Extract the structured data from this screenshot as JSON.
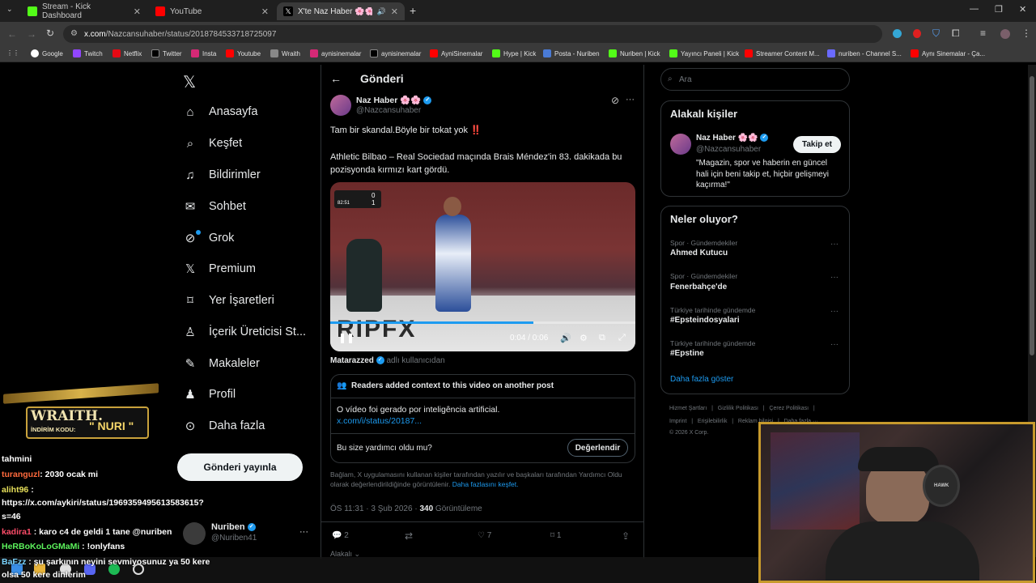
{
  "browser": {
    "tabs": [
      {
        "label": "Stream - Kick Dashboard",
        "icon": "kick-icon",
        "color": "#53fc18"
      },
      {
        "label": "YouTube",
        "icon": "youtube-icon",
        "color": "#ff0000"
      },
      {
        "label": "X'te Naz Haber 🌸🌸: \"Tam",
        "icon": "x-icon",
        "color": "#ffffff"
      }
    ],
    "url_host": "x.com",
    "url_path": "/Nazcansuhaber/status/2018784533718725097",
    "bookmarks": [
      "Google",
      "Twitch",
      "Netflix",
      "Twitter",
      "Insta",
      "Youtube",
      "Wraith",
      "aynisinemalar",
      "aynisinemalar",
      "AyniSinemalar",
      "Hype | Kick",
      "Posta - Nuriben",
      "Nuriben | Kick",
      "Yayıncı Paneli | Kick",
      "Streamer Content M...",
      "nuriben - Channel S...",
      "Aynı Sinemalar - Ça..."
    ]
  },
  "nav": {
    "items": [
      {
        "label": "Anasayfa",
        "icon": "home-icon"
      },
      {
        "label": "Keşfet",
        "icon": "search-icon"
      },
      {
        "label": "Bildirimler",
        "icon": "bell-icon"
      },
      {
        "label": "Sohbet",
        "icon": "mail-icon"
      },
      {
        "label": "Grok",
        "icon": "grok-icon"
      },
      {
        "label": "Premium",
        "icon": "x-icon"
      },
      {
        "label": "Yer İşaretleri",
        "icon": "bookmark-icon"
      },
      {
        "label": "İçerik Üreticisi St...",
        "icon": "creator-icon"
      },
      {
        "label": "Makaleler",
        "icon": "article-icon"
      },
      {
        "label": "Profil",
        "icon": "person-icon"
      },
      {
        "label": "Daha fazla",
        "icon": "more-circle-icon"
      }
    ],
    "post_button": "Gönderi yayınla",
    "account_name": "Nuriben",
    "account_handle": "@Nuriben41"
  },
  "post": {
    "header": "Gönderi",
    "author_name": "Naz Haber 🌸🌸",
    "author_handle": "@Nazcansuhaber",
    "text_1": "Tam bir skandal.Böyle bir tokat yok ‼️",
    "text_2": "Athletic Bilbao – Real Sociedad maçında Brais Méndez'in 83. dakikada bu pozisyonda kırmızı kart gördü.",
    "video_time": "0:04 / 0:06",
    "video_progress": 0.667,
    "scoreboard": {
      "minute": "82:51",
      "score_home": "0",
      "score_away": "1"
    },
    "video_source_name": "Matarazzed",
    "video_source_suffix": "adlı kullanıcıdan",
    "community_note_header": "Readers added context to this video on another post",
    "community_note_text": "O vídeo foi gerado por inteligência artificial.",
    "community_note_link": "x.com/i/status/20187...",
    "helpful_question": "Bu size yardımcı oldu mu?",
    "rate_button": "Değerlendir",
    "disclaimer": "Bağlam, X uygulamasını kullanan kişiler tarafından yazılır ve başkaları tarafından Yardımcı Oldu olarak değerlendirildiğinde görüntülenir.",
    "disclaimer_link": "Daha fazlasını keşfet.",
    "timestamp": "ÖS 11:31 · 3 Şub 2026 · ",
    "views_count": "340",
    "views_label": "Görüntüleme",
    "replies": "2",
    "likes": "7",
    "bookmarks": "1",
    "more_label": "Alakalı"
  },
  "right": {
    "search_placeholder": "Ara",
    "related_title": "Alakalı kişiler",
    "related_name": "Naz Haber 🌸🌸",
    "related_handle": "@Nazcansuhaber",
    "related_bio": "\"Magazin, spor ve haberin en güncel hali için beni takip et, hiçbir gelişmeyi kaçırma!\"",
    "follow_button": "Takip et",
    "trends_title": "Neler oluyor?",
    "trends": [
      {
        "category": "Spor · Gündemdekiler",
        "name": "Ahmed Kutucu"
      },
      {
        "category": "Spor · Gündemdekiler",
        "name": "Fenerbahçe'de"
      },
      {
        "category": "Türkiye tarihinde gündemde",
        "name": "#Epsteindosyalari"
      },
      {
        "category": "Türkiye tarihinde gündemde",
        "name": "#Epstine"
      }
    ],
    "show_more": "Daha fazla göster",
    "footer_1": "Hizmet Şartları   |   Gizlilik Politikası   |   Çerez Politikası   |",
    "footer_2": "Imprint   |   Erişilebilirlik   |   Reklam bilgisi   |   Daha fazla ···",
    "footer_3": "© 2026 X Corp."
  },
  "overlay": {
    "banner_title": "WRAITH.",
    "banner_code_label": "İNDİRİM KODU:",
    "banner_code": "\" NURI \"",
    "chat": [
      {
        "user": "",
        "color": "#ffffff",
        "text": "tahmini"
      },
      {
        "user": "turanguzl",
        "color": "#ff6a3d",
        "text": ": 2030 ocak mi"
      },
      {
        "user": "aliht96",
        "color": "#e7e05a",
        "text": ":"
      },
      {
        "user": "",
        "color": "#ffffff",
        "text": "https://x.com/aykiri/status/1969359495613583615?"
      },
      {
        "user": "",
        "color": "#ffffff",
        "text": "s=46"
      },
      {
        "user": "kadira1",
        "color": "#ff4d6a",
        "text": ": karo c4 de geldi 1 tane @nuriben"
      },
      {
        "user": "HeRBoKoLoGMaMi",
        "color": "#5cf25c",
        "text": ": !onlyfans"
      },
      {
        "user": "BaFzz",
        "color": "#7cd6ff",
        "text": ": şu şarkının neyini sevmiyosunuz ya 50 kere"
      },
      {
        "user": "",
        "color": "#ffffff",
        "text": "olsa 50 kere dinlerim"
      }
    ],
    "webcam_mic_brand": "HAWK"
  }
}
